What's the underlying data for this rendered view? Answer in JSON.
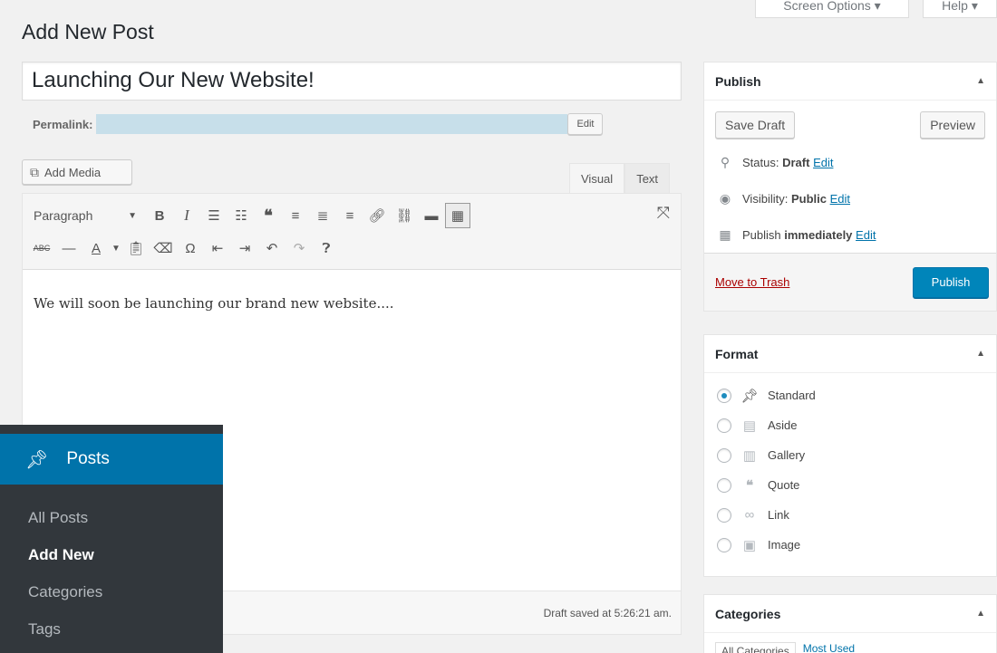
{
  "screen_tabs": {
    "screen_options": "Screen Options ▾",
    "help": "Help ▾"
  },
  "page_title": "Add New Post",
  "post_title": "Launching Our New Website!",
  "permalink": {
    "label": "Permalink:",
    "edit": "Edit"
  },
  "add_media": "Add Media",
  "editor_tabs": {
    "visual": "Visual",
    "text": "Text"
  },
  "toolbar": {
    "format_select": "Paragraph",
    "row1_icons": [
      "bold-icon",
      "italic-icon",
      "bulleted-list-icon",
      "numbered-list-icon",
      "blockquote-icon",
      "align-left-icon",
      "align-center-icon",
      "align-right-icon",
      "link-icon",
      "unlink-icon",
      "read-more-icon",
      "toolbar-toggle-icon"
    ],
    "row2_icons": [
      "strikethrough-icon",
      "horizontal-line-icon",
      "text-color-icon",
      "paste-text-icon",
      "clear-formatting-icon",
      "special-character-icon",
      "outdent-icon",
      "indent-icon",
      "undo-icon",
      "redo-icon",
      "help-icon"
    ]
  },
  "content": "We will soon be launching our brand new website....",
  "status_bar": "Draft saved at 5:26:21 am.",
  "admin_menu": {
    "header": "Posts",
    "items": [
      {
        "label": "All Posts",
        "current": false
      },
      {
        "label": "Add New",
        "current": true
      },
      {
        "label": "Categories",
        "current": false
      },
      {
        "label": "Tags",
        "current": false
      }
    ]
  },
  "publish": {
    "title": "Publish",
    "save_draft": "Save Draft",
    "preview": "Preview",
    "status_label": "Status:",
    "status_value": "Draft",
    "visibility_label": "Visibility:",
    "visibility_value": "Public",
    "publish_label": "Publish",
    "publish_value": "immediately",
    "edit": "Edit",
    "move_to_trash": "Move to Trash",
    "publish_button": "Publish"
  },
  "format": {
    "title": "Format",
    "options": [
      {
        "label": "Standard",
        "icon": "pushpin-icon",
        "checked": true
      },
      {
        "label": "Aside",
        "icon": "aside-icon",
        "checked": false
      },
      {
        "label": "Gallery",
        "icon": "gallery-icon",
        "checked": false
      },
      {
        "label": "Quote",
        "icon": "quote-icon",
        "checked": false
      },
      {
        "label": "Link",
        "icon": "link-icon",
        "checked": false
      },
      {
        "label": "Image",
        "icon": "image-icon",
        "checked": false
      }
    ]
  },
  "categories": {
    "title": "Categories",
    "tab_all": "All Categories",
    "tab_most_used": "Most Used"
  },
  "colors": {
    "accent": "#0073aa",
    "publish": "#0085ba",
    "admin_bg": "#23282d",
    "trash": "#a00000"
  }
}
